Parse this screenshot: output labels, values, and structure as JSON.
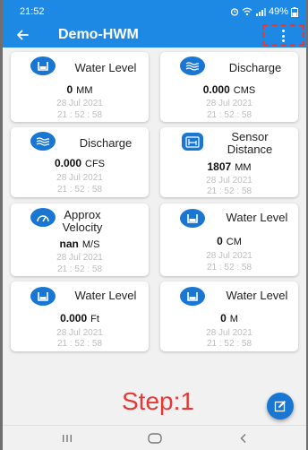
{
  "status": {
    "time": "21:52",
    "battery": "49%"
  },
  "appbar": {
    "title": "Demo-HWM"
  },
  "cards": [
    {
      "title": "Water Level",
      "value": "0",
      "unit": "MM",
      "date": "28 Jul 2021",
      "time": "21 : 52 : 58",
      "icon": "water-level-icon"
    },
    {
      "title": "Discharge",
      "value": "0.000",
      "unit": "CMS",
      "date": "28 Jul 2021",
      "time": "21 : 52 : 58",
      "icon": "discharge-icon"
    },
    {
      "title": "Discharge",
      "value": "0.000",
      "unit": "CFS",
      "date": "28 Jul 2021",
      "time": "21 : 52 : 58",
      "icon": "discharge-icon"
    },
    {
      "title": "Sensor Distance",
      "value": "1807",
      "unit": "MM",
      "date": "28 Jul 2021",
      "time": "21 : 52 : 58",
      "icon": "sensor-distance-icon"
    },
    {
      "title": "Approx Velocity",
      "value": "nan",
      "unit": "M/S",
      "date": "28 Jul 2021",
      "time": "21 : 52 : 58",
      "icon": "velocity-gauge-icon"
    },
    {
      "title": "Water Level",
      "value": "0",
      "unit": "CM",
      "date": "28 Jul 2021",
      "time": "21 : 52 : 58",
      "icon": "water-level-icon"
    },
    {
      "title": "Water Level",
      "value": "0.000",
      "unit": "Ft",
      "date": "28 Jul 2021",
      "time": "21 : 52 : 58",
      "icon": "water-level-icon"
    },
    {
      "title": "Water Level",
      "value": "0",
      "unit": "M",
      "date": "28 Jul 2021",
      "time": "21 : 52 : 58",
      "icon": "water-level-icon"
    }
  ],
  "step_label": "Step:1",
  "colors": {
    "primary": "#1e88e5",
    "icon": "#1976d2",
    "annotation": "#e53935",
    "muted_text": "#bdbdbd"
  }
}
